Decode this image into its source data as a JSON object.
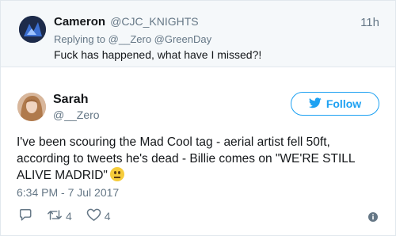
{
  "reply_context": {
    "name": "Cameron",
    "handle": "@CJC_KNIGHTS",
    "time": "11h",
    "replying_prefix": "Replying to",
    "mentions": "@__Zero @GreenDay",
    "text": "Fuck has happened, what have I missed?!"
  },
  "tweet": {
    "name": "Sarah",
    "handle": "@__Zero",
    "follow_label": "Follow",
    "text": "I've been scouring the Mad Cool tag - aerial artist fell 50ft, according to tweets he's dead - Billie comes on \"WE'RE STILL ALIVE MADRID\"",
    "timestamp": "6:34 PM - 7 Jul 2017",
    "retweets": "4",
    "likes": "4"
  },
  "colors": {
    "accent": "#1da1f2",
    "muted": "#657786"
  },
  "icons": [
    "reply-icon",
    "retweet-icon",
    "heart-icon",
    "info-icon",
    "twitter-bird-icon",
    "neutral-face-emoji"
  ]
}
